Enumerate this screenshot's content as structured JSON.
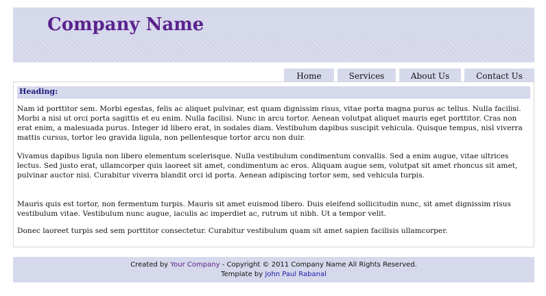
{
  "header": {
    "company_name": "Company Name"
  },
  "nav": {
    "items": [
      "Home",
      "Services",
      "About Us",
      "Contact Us"
    ]
  },
  "content": {
    "heading": "Heading:",
    "paragraphs": [
      "Nam id porttitor sem. Morbi egestas, felis ac aliquet pulvinar, est quam dignissim risus, vitae porta magna purus ac tellus. Nulla facilisi. Morbi a nisi ut orci porta sagittis et eu enim. Nulla facilisi. Nunc in arcu tortor. Aenean volutpat aliquet mauris eget porttitor. Cras non erat enim, a malesuada purus. Integer id libero erat, in sodales diam. Vestibulum dapibus suscipit vehicula. Quisque tempus, nisl viverra mattis cursus, tortor leo gravida ligula, non pellentesque tortor arcu non duir.",
      "Vivamus dapibus ligula non libero elementum scelerisque. Nulla vestibulum condimentum convallis. Sed a enim augue, vitae ultrices lectus. Sed justo erat, ullamcorper quis laoreet sit amet, condimentum ac eros. Aliquam augue sem, volutpat sit amet rhoncus sit amet, pulvinar auctor nisi. Curabitur viverra blandit orci id porta. Aenean adipiscing tortor sem, sed vehicula turpis.",
      "Mauris quis est tortor, non fermentum turpis. Mauris sit amet euismod libero. Duis eleifend sollicitudin nunc, sit amet dignissim risus vestibulum vitae. Vestibulum nunc augue, iaculis ac imperdiet ac, rutrum ut nibh. Ut a tempor velit.",
      "Donec laoreet turpis sed sem porttitor consectetur. Curabitur vestibulum quam sit amet sapien facilisis ullamcorper."
    ]
  },
  "footer": {
    "created_by": "Created by",
    "your_company": "Your Company",
    "copyright": "- Copyright © 2011 Company Name All Rights Reserved.",
    "template_by": "Template by",
    "author": "John Paul Rabanal"
  },
  "colors": {
    "band": "#d6d8ec",
    "brand": "#5a238c",
    "link": "#1a1aa8"
  }
}
